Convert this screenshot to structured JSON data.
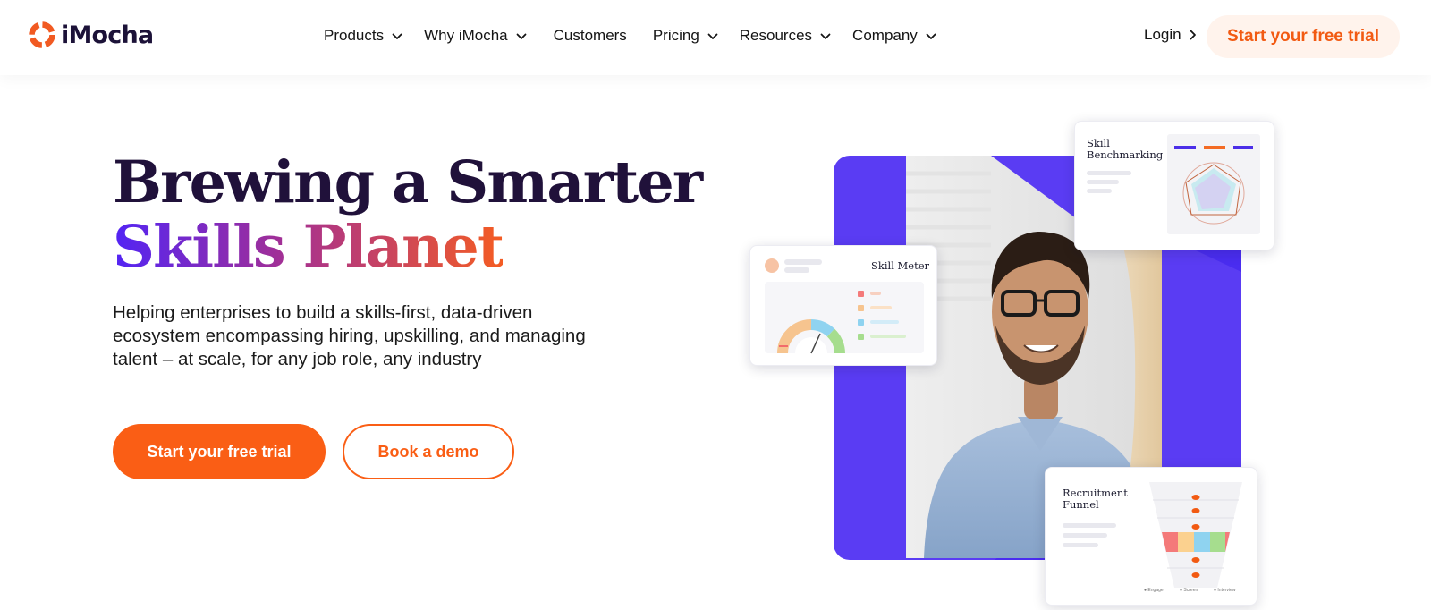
{
  "brand": {
    "name": "iMocha",
    "accent": "#fa5e15",
    "dark": "#20113a",
    "purple": "#5a3cf3"
  },
  "nav": {
    "items": [
      {
        "label": "Products",
        "has_dropdown": true
      },
      {
        "label": "Why iMocha",
        "has_dropdown": true
      },
      {
        "label": "Customers",
        "has_dropdown": false
      },
      {
        "label": "Pricing",
        "has_dropdown": true
      },
      {
        "label": "Resources",
        "has_dropdown": true
      },
      {
        "label": "Company",
        "has_dropdown": true
      }
    ],
    "login_label": "Login",
    "cta_label": "Start your free trial"
  },
  "hero": {
    "title_line1": "Brewing a Smarter",
    "title_line2": "Skills Planet",
    "description": "Helping enterprises to build a skills-first, data-driven ecosystem encompassing hiring, upskilling, and managing talent – at scale, for any job role, any industry",
    "primary_cta": "Start your free trial",
    "secondary_cta": "Book a demo"
  },
  "illustration": {
    "skill_meter": {
      "title": "Skill Meter"
    },
    "skill_benchmarking": {
      "title": "Skill\nBenchmarking"
    },
    "recruitment_funnel": {
      "title": "Recruitment\nFunnel",
      "legend": [
        "Engage",
        "Screen",
        "Interview"
      ]
    }
  }
}
